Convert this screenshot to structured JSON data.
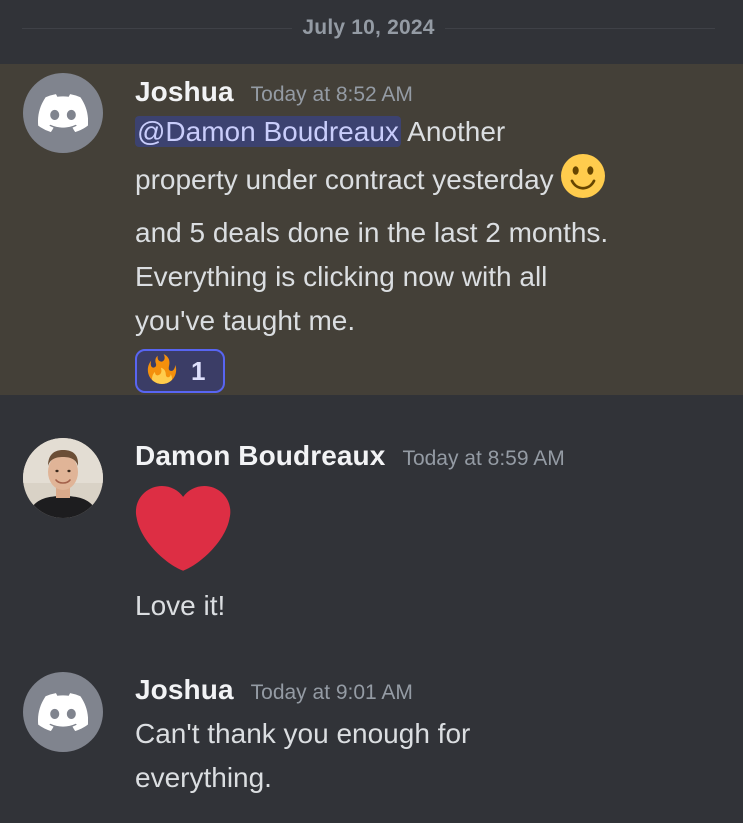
{
  "date_divider": "July 10, 2024",
  "messages": [
    {
      "author": "Joshua",
      "timestamp": "Today at 8:52 AM",
      "mention": "@Damon Boudreaux",
      "text_part1": " Another property under contract yesterday ",
      "text_part2": "and 5 deals done in the last 2 months. Everything is clicking now with all you've taught me.",
      "inline_emoji": "slightly-smiling-face",
      "reaction": {
        "emoji": "fire",
        "count": "1"
      },
      "avatar_icon": "discord-logo-icon"
    },
    {
      "author": "Damon Boudreaux",
      "timestamp": "Today at 8:59 AM",
      "emoji": "red-heart",
      "text": "Love it!",
      "avatar": "profile-photo"
    },
    {
      "author": "Joshua",
      "timestamp": "Today at 9:01 AM",
      "text": "Can't thank you enough for everything.",
      "avatar_icon": "discord-logo-icon"
    }
  ],
  "colors": {
    "background": "#313338",
    "highlight": "#444038",
    "mention_bg": "#3c4270",
    "mention_text": "#c9cdfb",
    "reaction_border": "#5865f2",
    "heart": "#dd2e44"
  }
}
